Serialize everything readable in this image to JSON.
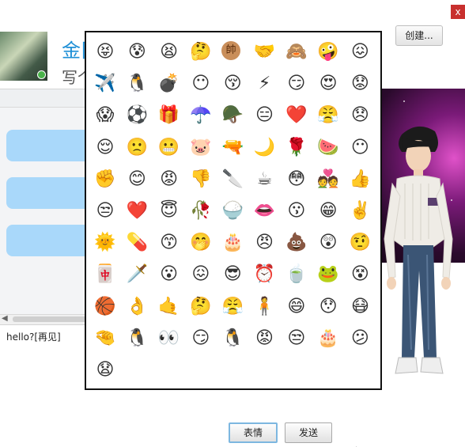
{
  "window": {
    "close_label": "x"
  },
  "contact": {
    "name": "金阝",
    "signature": "写个"
  },
  "toolbar": {
    "create_label": "创建..."
  },
  "input": {
    "text": "hello?[再见]"
  },
  "buttons": {
    "emoji_label": "表情",
    "send_label": "发送"
  },
  "emoji_grid": {
    "columns": 9,
    "items": [
      "😝",
      "😰",
      "😫",
      "🤔",
      "帥",
      "🤝",
      "🙈",
      "🤪",
      "😖",
      "✈️",
      "🐧",
      "💣",
      "😶",
      "😚",
      "⚡",
      "😏",
      "😍",
      "😟",
      "😱",
      "⚽",
      "🎁",
      "☂️",
      "🪖",
      "😑",
      "❤️",
      "😤",
      "😞",
      "😌",
      "🙁",
      "😬",
      "🐷",
      "🔫",
      "🌙",
      "🌹",
      "🍉",
      "😶",
      "✊",
      "😊",
      "😡",
      "👎",
      "🔪",
      "☕",
      "😳",
      "💑",
      "👍",
      "😒",
      "❤️",
      "😇",
      "🥀",
      "🍚",
      "👄",
      "😗",
      "😁",
      "✌️",
      "🌞",
      "💊",
      "😙",
      "🤭",
      "🎂",
      "😠",
      "💩",
      "😲",
      "🤨",
      "🀄",
      "🗡️",
      "😮",
      "😖",
      "😎",
      "⏰",
      "🍵",
      "🐸",
      "😵",
      "🏀",
      "👌",
      "🤙",
      "🤔",
      "😤",
      "🧍",
      "😄",
      "😯",
      "😷",
      "🤏",
      "🐧",
      "👀",
      "😏",
      "🐧",
      "😡",
      "😒",
      "🎂",
      "😕",
      "😧"
    ]
  }
}
